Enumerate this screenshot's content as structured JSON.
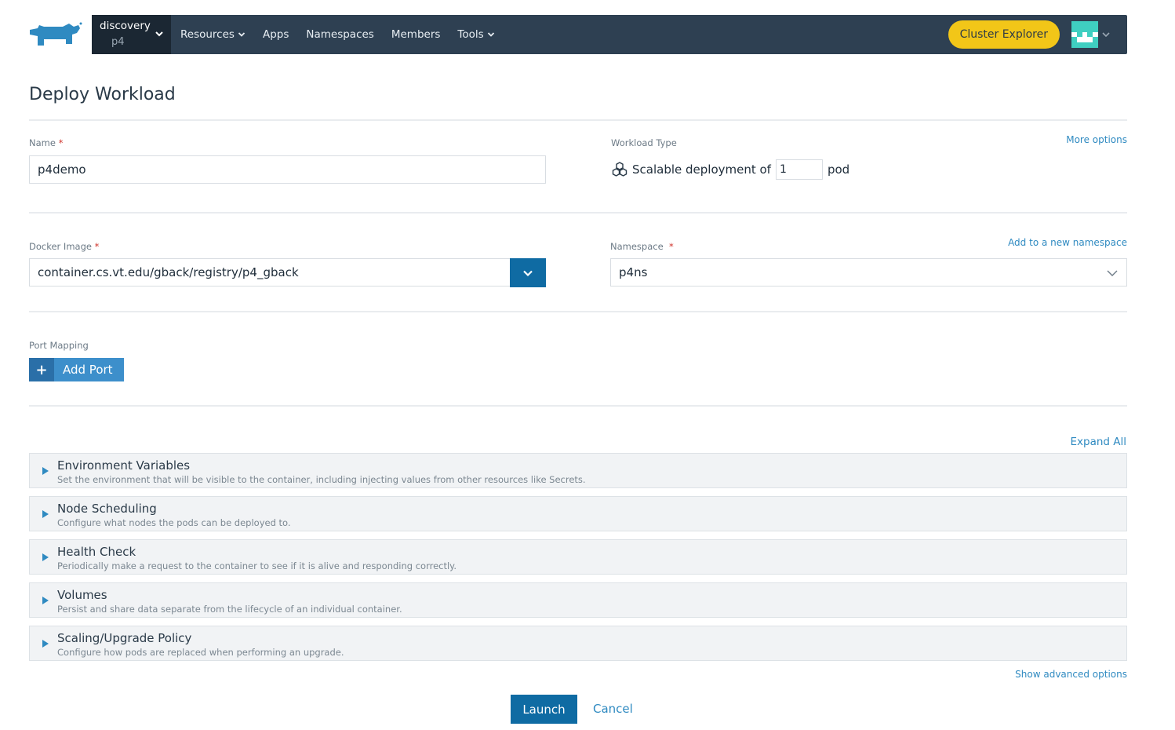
{
  "nav": {
    "cluster": "discovery",
    "project": "p4",
    "items": [
      {
        "label": "Resources",
        "dropdown": true
      },
      {
        "label": "Apps",
        "dropdown": false
      },
      {
        "label": "Namespaces",
        "dropdown": false
      },
      {
        "label": "Members",
        "dropdown": false
      },
      {
        "label": "Tools",
        "dropdown": true
      }
    ],
    "explorer_label": "Cluster Explorer"
  },
  "page": {
    "title": "Deploy Workload"
  },
  "form": {
    "name_label": "Name",
    "name_required": "*",
    "name_value": "p4demo",
    "workload_type_label": "Workload Type",
    "more_options": "More options",
    "workload_prefix": "Scalable deployment of",
    "scale_value": "1",
    "workload_suffix": "pod",
    "image_label": "Docker Image",
    "image_required": "*",
    "image_value": "container.cs.vt.edu/gback/registry/p4_gback",
    "namespace_label": "Namespace",
    "namespace_required": "*",
    "add_namespace": "Add to a new namespace",
    "namespace_value": "p4ns",
    "port_mapping_label": "Port Mapping",
    "add_port_label": "Add Port",
    "add_port_icon": "+"
  },
  "sections": {
    "expand_all": "Expand All",
    "items": [
      {
        "title": "Environment Variables",
        "desc": "Set the environment that will be visible to the container, including injecting values from other resources like Secrets."
      },
      {
        "title": "Node Scheduling",
        "desc": "Configure what nodes the pods can be deployed to."
      },
      {
        "title": "Health Check",
        "desc": "Periodically make a request to the container to see if it is alive and responding correctly."
      },
      {
        "title": "Volumes",
        "desc": "Persist and share data separate from the lifecycle of an individual container."
      },
      {
        "title": "Scaling/Upgrade Policy",
        "desc": "Configure how pods are replaced when performing an upgrade."
      }
    ],
    "show_advanced": "Show advanced options"
  },
  "actions": {
    "launch": "Launch",
    "cancel": "Cancel"
  },
  "colors": {
    "nav_bg": "#2e4052",
    "cluster_bg": "#1b2733",
    "accent_blue": "#0f6ba3",
    "link_blue": "#2f8ac1",
    "explorer_yellow": "#f2c618"
  }
}
